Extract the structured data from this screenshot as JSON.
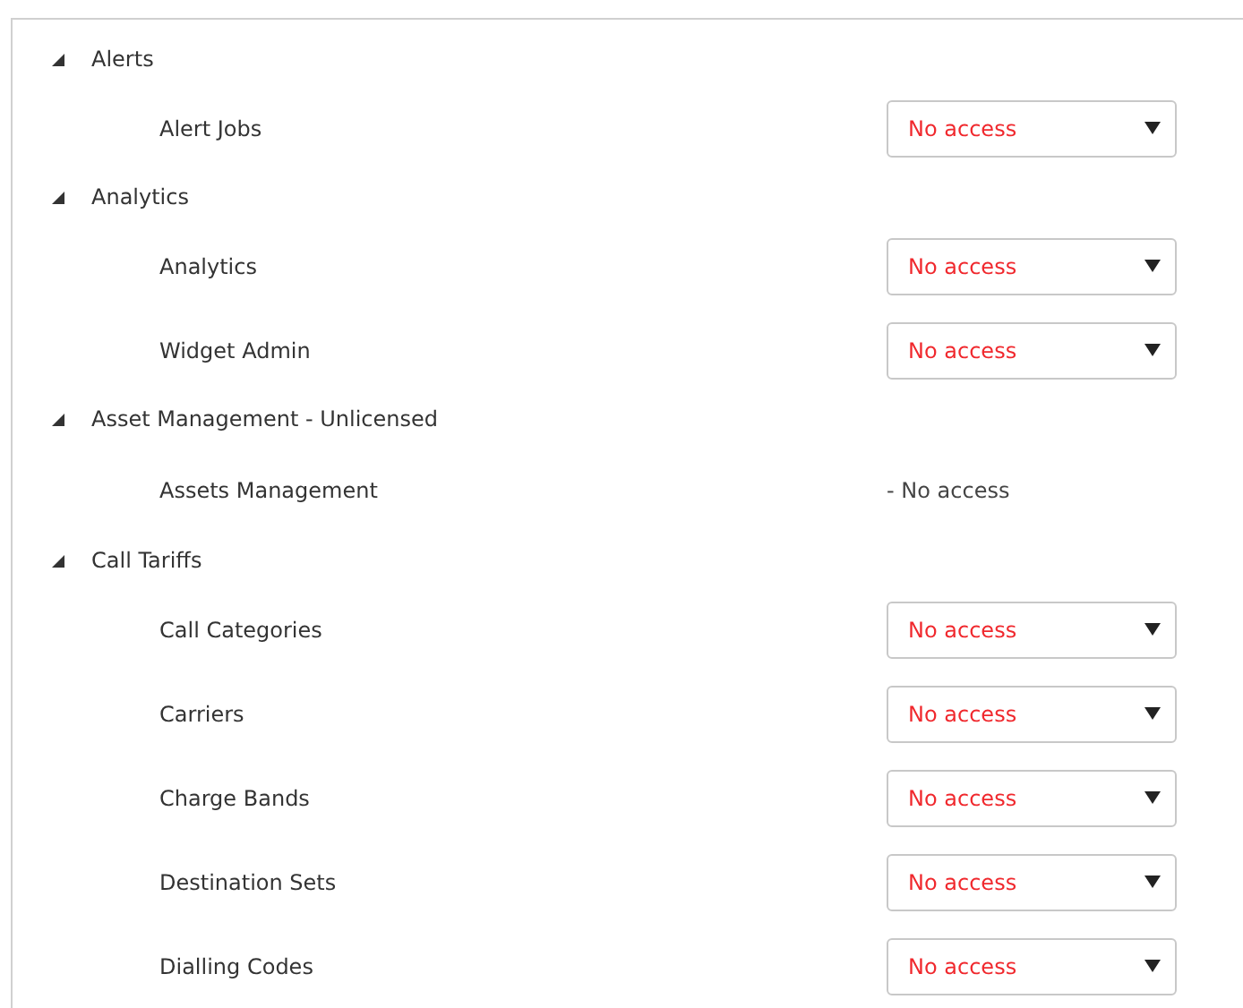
{
  "groups": [
    {
      "label": "Alerts",
      "expanded": true,
      "children": [
        {
          "label": "Alert Jobs",
          "kind": "select",
          "value": "No access"
        }
      ]
    },
    {
      "label": "Analytics",
      "expanded": true,
      "children": [
        {
          "label": "Analytics",
          "kind": "select",
          "value": "No access"
        },
        {
          "label": "Widget Admin",
          "kind": "select",
          "value": "No access"
        }
      ]
    },
    {
      "label": "Asset Management - Unlicensed",
      "expanded": true,
      "children": [
        {
          "label": "Assets Management",
          "kind": "text",
          "value": "- No access"
        }
      ]
    },
    {
      "label": "Call Tariffs",
      "expanded": true,
      "children": [
        {
          "label": "Call Categories",
          "kind": "select",
          "value": "No access"
        },
        {
          "label": "Carriers",
          "kind": "select",
          "value": "No access"
        },
        {
          "label": "Charge Bands",
          "kind": "select",
          "value": "No access"
        },
        {
          "label": "Destination Sets",
          "kind": "select",
          "value": "No access"
        },
        {
          "label": "Dialling Codes",
          "kind": "select",
          "value": "No access"
        }
      ]
    }
  ]
}
